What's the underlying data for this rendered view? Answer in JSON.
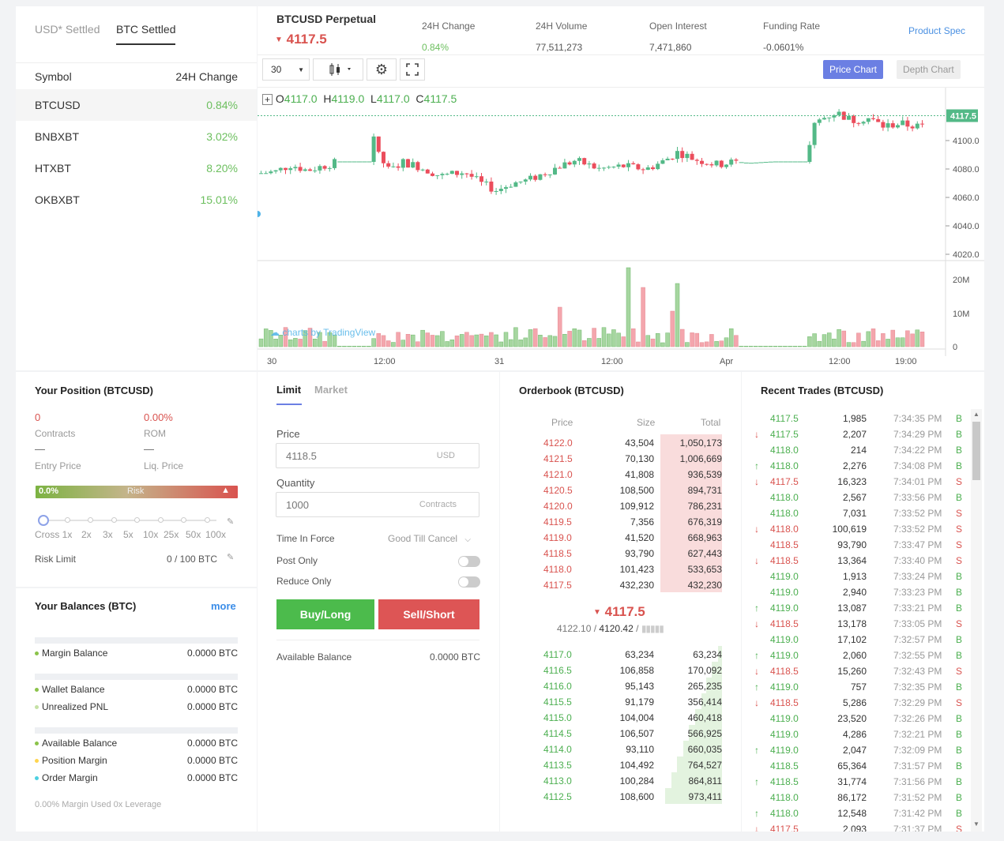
{
  "markets": {
    "tabs": [
      "USD* Settled",
      "BTC Settled"
    ],
    "header": {
      "symbol": "Symbol",
      "change": "24H Change"
    },
    "rows": [
      {
        "symbol": "BTCUSD",
        "change": "0.84%"
      },
      {
        "symbol": "BNBXBT",
        "change": "3.02%"
      },
      {
        "symbol": "HTXBT",
        "change": "8.20%"
      },
      {
        "symbol": "OKBXBT",
        "change": "15.01%"
      }
    ]
  },
  "ticker": {
    "name": "BTCUSD Perpetual",
    "price": "4117.5",
    "change_label": "24H Change",
    "change": "0.84%",
    "volume_label": "24H Volume",
    "volume": "77,511,273",
    "oi_label": "Open Interest",
    "oi": "7,471,860",
    "funding_label": "Funding Rate",
    "funding": "-0.0601%",
    "product_spec": "Product Spec"
  },
  "chart_toolbar": {
    "interval": "30",
    "price_chart": "Price Chart",
    "depth_chart": "Depth Chart"
  },
  "ohlc": {
    "o_label": "O",
    "o": "4117.0",
    "h_label": "H",
    "h": "4119.0",
    "l_label": "L",
    "l": "4117.0",
    "c_label": "C",
    "c": "4117.5"
  },
  "watermark": "charts by TradingView",
  "chart_data": {
    "type": "candlestick",
    "price_axis_ticks": [
      "4100.0",
      "4080.0",
      "4060.0",
      "4040.0",
      "4020.0"
    ],
    "last_price_label": "4117.5",
    "volume_axis_ticks": [
      "20M",
      "10M",
      "0"
    ],
    "time_axis_ticks": [
      "30",
      "12:00",
      "31",
      "12:00",
      "Apr",
      "12:00",
      "19:00"
    ]
  },
  "position": {
    "title": "Your Position (BTCUSD)",
    "contracts": "0",
    "contracts_label": "Contracts",
    "rom": "0.00%",
    "rom_label": "ROM",
    "entry_price": "—",
    "entry_label": "Entry Price",
    "liq_price": "—",
    "liq_label": "Liq. Price",
    "risk_pct": "0.0%",
    "risk_label": "Risk",
    "leverage_marks": [
      "Cross 1x",
      "2x",
      "3x",
      "5x",
      "10x",
      "25x",
      "50x",
      "100x"
    ],
    "risk_limit_label": "Risk Limit",
    "risk_limit": "0 / 100 BTC"
  },
  "balances": {
    "title": "Your Balances (BTC)",
    "more": "more",
    "rows": [
      {
        "label": "Margin Balance",
        "value": "0.0000 BTC",
        "color": "#8bc34a"
      },
      {
        "label": "Wallet Balance",
        "value": "0.0000 BTC",
        "color": "#8bc34a"
      },
      {
        "label": "Unrealized PNL",
        "value": "0.0000 BTC",
        "color": "#c5e1a5"
      },
      {
        "label": "Available Balance",
        "value": "0.0000 BTC",
        "color": "#8bc34a"
      },
      {
        "label": "Position Margin",
        "value": "0.0000 BTC",
        "color": "#ffd54f"
      },
      {
        "label": "Order Margin",
        "value": "0.0000 BTC",
        "color": "#4dd0e1"
      }
    ],
    "footer": "0.00% Margin Used 0x Leverage"
  },
  "order_form": {
    "tabs": [
      "Limit",
      "Market"
    ],
    "price_label": "Price",
    "price_value": "4118.5",
    "price_unit": "USD",
    "qty_label": "Quantity",
    "qty_value": "1000",
    "qty_unit": "Contracts",
    "tif_label": "Time In Force",
    "tif_value": "Good Till Cancel",
    "post_only": "Post Only",
    "reduce_only": "Reduce Only",
    "buy": "Buy/Long",
    "sell": "Sell/Short",
    "avail_label": "Available Balance",
    "avail_value": "0.0000 BTC"
  },
  "orderbook": {
    "title": "Orderbook (BTCUSD)",
    "headers": [
      "Price",
      "Size",
      "Total"
    ],
    "asks": [
      [
        "4122.0",
        "43,504",
        "1,050,173"
      ],
      [
        "4121.5",
        "70,130",
        "1,006,669"
      ],
      [
        "4121.0",
        "41,808",
        "936,539"
      ],
      [
        "4120.5",
        "108,500",
        "894,731"
      ],
      [
        "4120.0",
        "109,912",
        "786,231"
      ],
      [
        "4119.5",
        "7,356",
        "676,319"
      ],
      [
        "4119.0",
        "41,520",
        "668,963"
      ],
      [
        "4118.5",
        "93,790",
        "627,443"
      ],
      [
        "4118.0",
        "101,423",
        "533,653"
      ],
      [
        "4117.5",
        "432,230",
        "432,230"
      ]
    ],
    "last": "4117.5",
    "index": "4122.10",
    "mark": "4120.42",
    "bids": [
      [
        "4117.0",
        "63,234",
        "63,234"
      ],
      [
        "4116.5",
        "106,858",
        "170,092"
      ],
      [
        "4116.0",
        "95,143",
        "265,235"
      ],
      [
        "4115.5",
        "91,179",
        "356,414"
      ],
      [
        "4115.0",
        "104,004",
        "460,418"
      ],
      [
        "4114.5",
        "106,507",
        "566,925"
      ],
      [
        "4114.0",
        "93,110",
        "660,035"
      ],
      [
        "4113.5",
        "104,492",
        "764,527"
      ],
      [
        "4113.0",
        "100,284",
        "864,811"
      ],
      [
        "4112.5",
        "108,600",
        "973,411"
      ]
    ]
  },
  "trades": {
    "title": "Recent Trades (BTCUSD)",
    "rows": [
      [
        "4117.5",
        "1,985",
        "7:34:35 PM",
        "B",
        "",
        "g"
      ],
      [
        "4117.5",
        "2,207",
        "7:34:29 PM",
        "B",
        "down",
        "g"
      ],
      [
        "4118.0",
        "214",
        "7:34:22 PM",
        "B",
        "",
        "g"
      ],
      [
        "4118.0",
        "2,276",
        "7:34:08 PM",
        "B",
        "up",
        "g"
      ],
      [
        "4117.5",
        "16,323",
        "7:34:01 PM",
        "S",
        "down",
        "r"
      ],
      [
        "4118.0",
        "2,567",
        "7:33:56 PM",
        "B",
        "",
        "g"
      ],
      [
        "4118.0",
        "7,031",
        "7:33:52 PM",
        "S",
        "",
        "g"
      ],
      [
        "4118.0",
        "100,619",
        "7:33:52 PM",
        "S",
        "down",
        "r"
      ],
      [
        "4118.5",
        "93,790",
        "7:33:47 PM",
        "S",
        "",
        "r"
      ],
      [
        "4118.5",
        "13,364",
        "7:33:40 PM",
        "S",
        "down",
        "r"
      ],
      [
        "4119.0",
        "1,913",
        "7:33:24 PM",
        "B",
        "",
        "g"
      ],
      [
        "4119.0",
        "2,940",
        "7:33:23 PM",
        "B",
        "",
        "g"
      ],
      [
        "4119.0",
        "13,087",
        "7:33:21 PM",
        "B",
        "up",
        "g"
      ],
      [
        "4118.5",
        "13,178",
        "7:33:05 PM",
        "S",
        "down",
        "r"
      ],
      [
        "4119.0",
        "17,102",
        "7:32:57 PM",
        "B",
        "",
        "g"
      ],
      [
        "4119.0",
        "2,060",
        "7:32:55 PM",
        "B",
        "up",
        "g"
      ],
      [
        "4118.5",
        "15,260",
        "7:32:43 PM",
        "S",
        "down",
        "r"
      ],
      [
        "4119.0",
        "757",
        "7:32:35 PM",
        "B",
        "up",
        "g"
      ],
      [
        "4118.5",
        "5,286",
        "7:32:29 PM",
        "S",
        "down",
        "r"
      ],
      [
        "4119.0",
        "23,520",
        "7:32:26 PM",
        "B",
        "",
        "g"
      ],
      [
        "4119.0",
        "4,286",
        "7:32:21 PM",
        "B",
        "",
        "g"
      ],
      [
        "4119.0",
        "2,047",
        "7:32:09 PM",
        "B",
        "up",
        "g"
      ],
      [
        "4118.5",
        "65,364",
        "7:31:57 PM",
        "B",
        "",
        "g"
      ],
      [
        "4118.5",
        "31,774",
        "7:31:56 PM",
        "B",
        "up",
        "g"
      ],
      [
        "4118.0",
        "86,172",
        "7:31:52 PM",
        "B",
        "",
        "g"
      ],
      [
        "4118.0",
        "12,548",
        "7:31:42 PM",
        "B",
        "up",
        "g"
      ],
      [
        "4117.5",
        "2,093",
        "7:31:37 PM",
        "S",
        "down",
        "r"
      ]
    ]
  }
}
